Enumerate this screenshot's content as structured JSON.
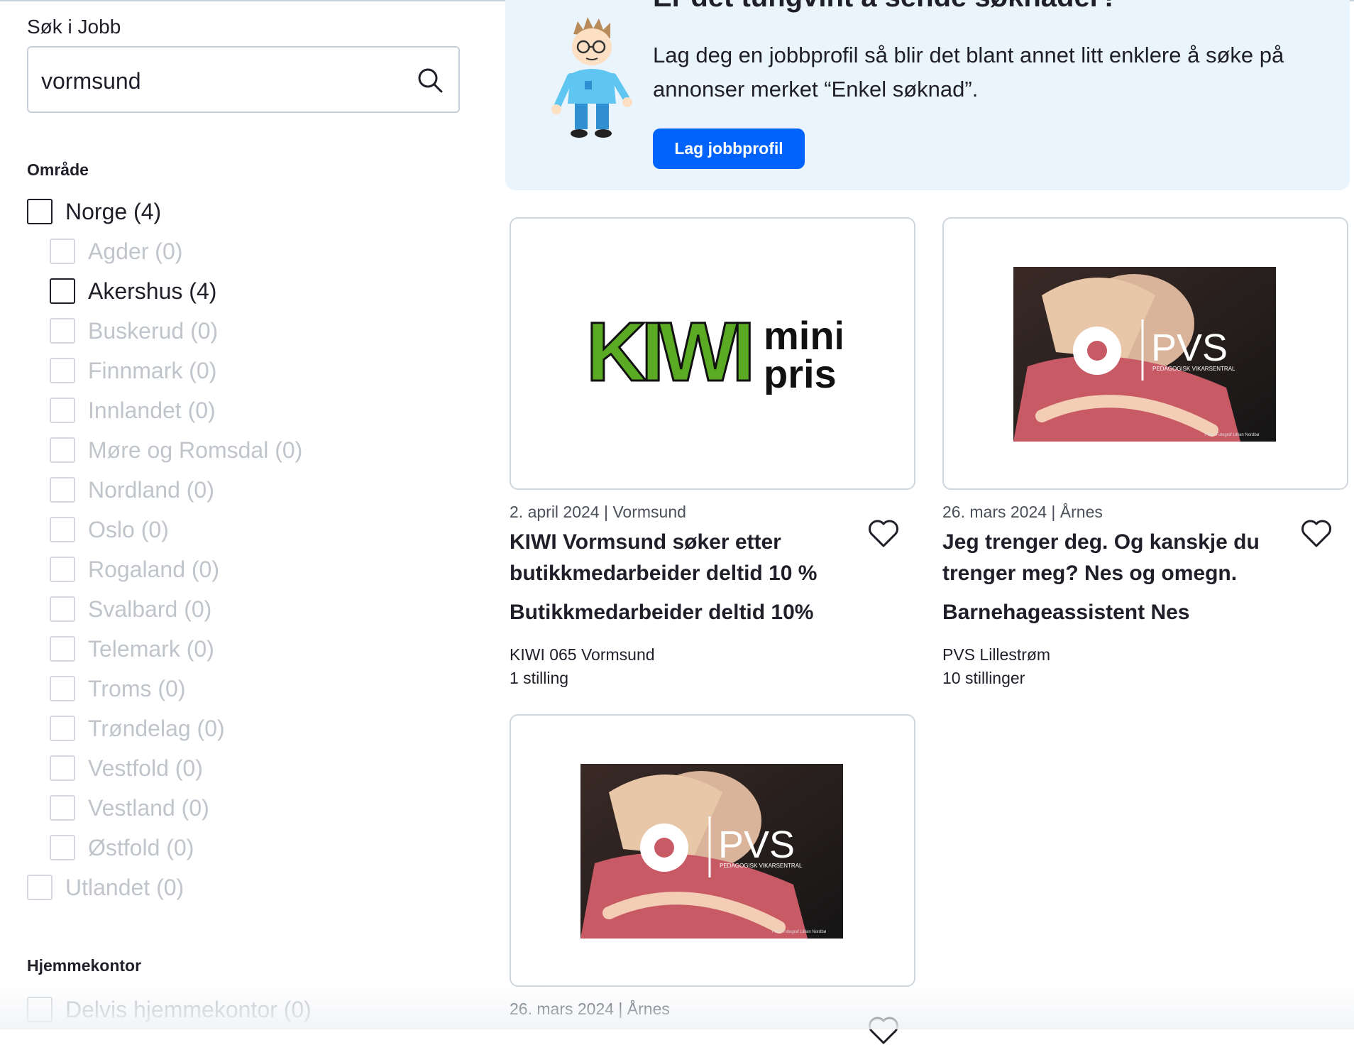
{
  "search": {
    "label": "Søk i Jobb",
    "value": "vormsund",
    "icon": "search-icon"
  },
  "area": {
    "title": "Område",
    "items": [
      {
        "label": "Norge (4)",
        "enabled": true,
        "level": 0
      },
      {
        "label": "Agder (0)",
        "enabled": false,
        "level": 1
      },
      {
        "label": "Akershus (4)",
        "enabled": true,
        "level": 1
      },
      {
        "label": "Buskerud (0)",
        "enabled": false,
        "level": 1
      },
      {
        "label": "Finnmark (0)",
        "enabled": false,
        "level": 1
      },
      {
        "label": "Innlandet (0)",
        "enabled": false,
        "level": 1
      },
      {
        "label": "Møre og Romsdal (0)",
        "enabled": false,
        "level": 1
      },
      {
        "label": "Nordland (0)",
        "enabled": false,
        "level": 1
      },
      {
        "label": "Oslo (0)",
        "enabled": false,
        "level": 1
      },
      {
        "label": "Rogaland (0)",
        "enabled": false,
        "level": 1
      },
      {
        "label": "Svalbard (0)",
        "enabled": false,
        "level": 1
      },
      {
        "label": "Telemark (0)",
        "enabled": false,
        "level": 1
      },
      {
        "label": "Troms (0)",
        "enabled": false,
        "level": 1
      },
      {
        "label": "Trøndelag (0)",
        "enabled": false,
        "level": 1
      },
      {
        "label": "Vestfold (0)",
        "enabled": false,
        "level": 1
      },
      {
        "label": "Vestland (0)",
        "enabled": false,
        "level": 1
      },
      {
        "label": "Østfold (0)",
        "enabled": false,
        "level": 1
      },
      {
        "label": "Utlandet (0)",
        "enabled": false,
        "level": 0
      }
    ]
  },
  "homeoffice": {
    "title": "Hjemmekontor",
    "items": [
      {
        "label": "Delvis hjemmekontor (0)",
        "enabled": false
      }
    ]
  },
  "banner": {
    "title": "Er det tungvint å sende søknader?",
    "text": "Lag deg en jobbprofil så blir det blant annet litt enklere å søke på annonser merket “Enkel søknad”.",
    "button": "Lag jobbprofil"
  },
  "cards": [
    {
      "meta": "2. april 2024 | Vormsund",
      "title": "KIWI Vormsund søker etter butikkmedarbeider deltid 10 %",
      "subtitle": "Butikkmedarbeider deltid 10%",
      "company": "KIWI 065 Vormsund",
      "count": "1 stilling",
      "logo": {
        "word": "KIWI",
        "line1": "mini",
        "line2": "pris",
        "color": "#5aaa23"
      }
    },
    {
      "meta": "26. mars 2024 | Årnes",
      "title": "Jeg trenger deg. Og kanskje du trenger meg? Nes og omegn.",
      "subtitle": "Barnehageassistent Nes",
      "company": "PVS Lillestrøm",
      "count": "10 stillinger",
      "logo": {
        "name": "PVS",
        "tagline": "PEDAGOGISK VIKARSENTRAL",
        "credit": "Foto: Fotograf Lillian Nordbø"
      }
    },
    {
      "meta": "26. mars 2024 | Årnes",
      "logo": {
        "name": "PVS",
        "tagline": "PEDAGOGISK VIKARSENTRAL",
        "credit": "Foto: Fotograf Lillian Nordbø"
      }
    }
  ],
  "colors": {
    "primary_button": "#0063fb",
    "banner_bg": "#eaf4fd",
    "kiwi_green": "#5aaa23"
  }
}
